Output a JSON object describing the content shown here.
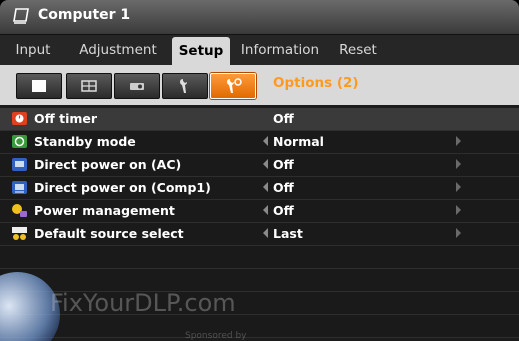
{
  "window": {
    "title": "Computer 1"
  },
  "tabs": [
    {
      "label": "Input"
    },
    {
      "label": "Adjustment"
    },
    {
      "label": "Setup"
    },
    {
      "label": "Information"
    },
    {
      "label": "Reset"
    }
  ],
  "active_tab": "Setup",
  "sub_page": {
    "title": "Options (2)"
  },
  "sub_icons": [
    "menu-icon",
    "grid-icon",
    "projector-icon",
    "wrench-icon",
    "wrench-options-icon"
  ],
  "settings": [
    {
      "label": "Off timer",
      "value": "Off",
      "icon": "timer-icon",
      "has_arrows": false
    },
    {
      "label": "Standby mode",
      "value": "Normal",
      "icon": "standby-icon",
      "has_arrows": true
    },
    {
      "label": "Direct power on (AC)",
      "value": "Off",
      "icon": "power-ac-icon",
      "has_arrows": true
    },
    {
      "label": "Direct power on (Comp1)",
      "value": "Off",
      "icon": "power-comp-icon",
      "has_arrows": true
    },
    {
      "label": "Power management",
      "value": "Off",
      "icon": "power-management-icon",
      "has_arrows": true
    },
    {
      "label": "Default source select",
      "value": "Last",
      "icon": "source-select-icon",
      "has_arrows": true
    }
  ],
  "watermark": {
    "text": "FixYourDLP.com",
    "sponsored": "Sponsored by"
  },
  "colors": {
    "accent": "#ff9a1a",
    "active_subicon": "#f07a10",
    "background": "#1a1a1a"
  }
}
